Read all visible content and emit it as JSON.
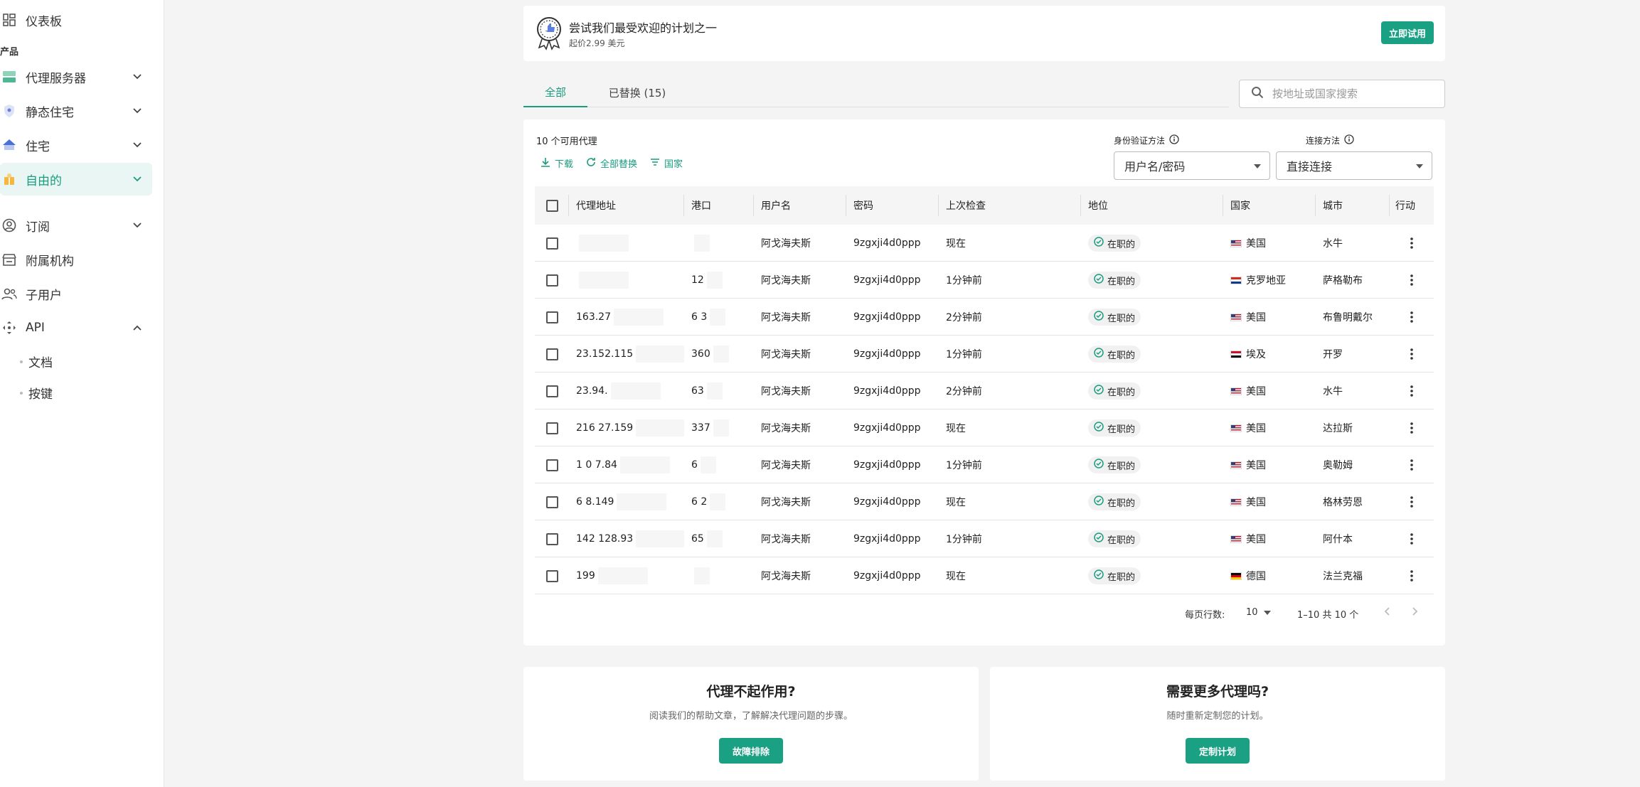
{
  "sidebar": {
    "dashboard": "仪表板",
    "section_products": "产品",
    "proxy_servers": "代理服务器",
    "static_residential": "静态住宅",
    "residential": "住宅",
    "free": "自由的",
    "subscriptions": "订阅",
    "affiliates": "附属机构",
    "sub_users": "子用户",
    "api": "API",
    "api_docs": "文档",
    "api_keys": "按键"
  },
  "promo": {
    "title": "尝试我们最受欢迎的计划之一",
    "subtitle": "起价2.99 美元",
    "cta": "立即试用"
  },
  "tabs": {
    "all": "全部",
    "replaced": "已替换 (15)"
  },
  "search": {
    "placeholder": "按地址或国家搜索"
  },
  "list": {
    "count_label": "10 个可用代理",
    "download": "下载",
    "replace_all": "全部替换",
    "country": "国家"
  },
  "filters": {
    "auth_label": "身份验证方法",
    "auth_value": "用户名/密码",
    "conn_label": "连接方法",
    "conn_value": "直接连接"
  },
  "table": {
    "headers": {
      "address": "代理地址",
      "port": "港口",
      "username": "用户名",
      "password": "密码",
      "last_check": "上次检查",
      "status": "地位",
      "country": "国家",
      "city": "城市",
      "action": "行动"
    },
    "rows": [
      {
        "address": "",
        "port": "",
        "username": "阿戈海夫斯",
        "password": "9zgxji4d0ppp",
        "last_check": "现在",
        "status": "在职的",
        "country": "美国",
        "city": "水牛"
      },
      {
        "address": "",
        "port": "12",
        "username": "阿戈海夫斯",
        "password": "9zgxji4d0ppp",
        "last_check": "1分钟前",
        "status": "在职的",
        "country": "克罗地亚",
        "city": "萨格勒布"
      },
      {
        "address": "163.27",
        "port": "6  3",
        "username": "阿戈海夫斯",
        "password": "9zgxji4d0ppp",
        "last_check": "2分钟前",
        "status": "在职的",
        "country": "美国",
        "city": "布鲁明戴尔"
      },
      {
        "address": "23.152.115",
        "port": "360",
        "username": "阿戈海夫斯",
        "password": "9zgxji4d0ppp",
        "last_check": "1分钟前",
        "status": "在职的",
        "country": "埃及",
        "city": "开罗"
      },
      {
        "address": "23.94.",
        "port": "63",
        "username": "阿戈海夫斯",
        "password": "9zgxji4d0ppp",
        "last_check": "2分钟前",
        "status": "在职的",
        "country": "美国",
        "city": "水牛"
      },
      {
        "address": "216   27.159",
        "port": "337",
        "username": "阿戈海夫斯",
        "password": "9zgxji4d0ppp",
        "last_check": "现在",
        "status": "在职的",
        "country": "美国",
        "city": "达拉斯"
      },
      {
        "address": "1   0   7.84",
        "port": "6",
        "username": "阿戈海夫斯",
        "password": "9zgxji4d0ppp",
        "last_check": "1分钟前",
        "status": "在职的",
        "country": "美国",
        "city": "奥勒姆"
      },
      {
        "address": "6   8.149",
        "port": "6  2",
        "username": "阿戈海夫斯",
        "password": "9zgxji4d0ppp",
        "last_check": "现在",
        "status": "在职的",
        "country": "美国",
        "city": "格林劳恩"
      },
      {
        "address": "142   128.93",
        "port": "65",
        "username": "阿戈海夫斯",
        "password": "9zgxji4d0ppp",
        "last_check": "1分钟前",
        "status": "在职的",
        "country": "美国",
        "city": "阿什本"
      },
      {
        "address": "199",
        "port": "",
        "username": "阿戈海夫斯",
        "password": "9zgxji4d0ppp",
        "last_check": "现在",
        "status": "在职的",
        "country": "德国",
        "city": "法兰克福"
      }
    ]
  },
  "pagination": {
    "rows_per_page_label": "每页行数:",
    "rows_per_page": "10",
    "range": "1–10 共 10 个"
  },
  "help": {
    "left_title": "代理不起作用?",
    "left_text": "阅读我们的帮助文章，了解解决代理问题的步骤。",
    "left_button": "故障排除",
    "right_title": "需要更多代理吗?",
    "right_text": "随时重新定制您的计划。",
    "right_button": "定制计划"
  },
  "colors": {
    "accent": "#1aa083",
    "active_bg": "#eaf6f3"
  }
}
